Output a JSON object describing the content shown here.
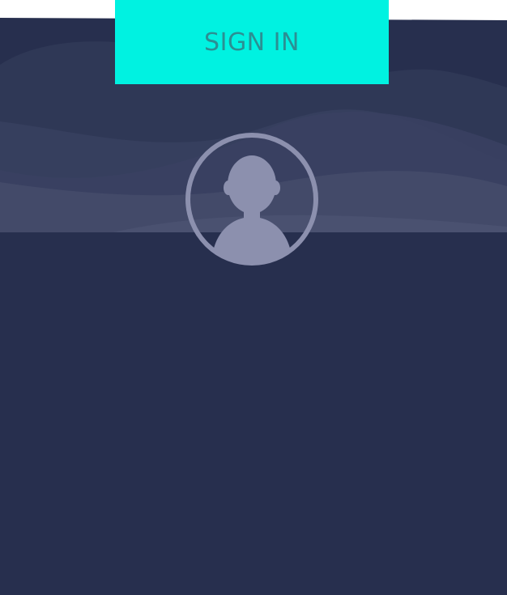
{
  "colors": {
    "background": "#272f4e",
    "accent": "#00f2e1",
    "accent_text": "#2b8f93",
    "avatar": "#8c90ae"
  },
  "signin": {
    "label": "SIGN IN"
  },
  "avatar": {
    "icon": "user-icon"
  }
}
